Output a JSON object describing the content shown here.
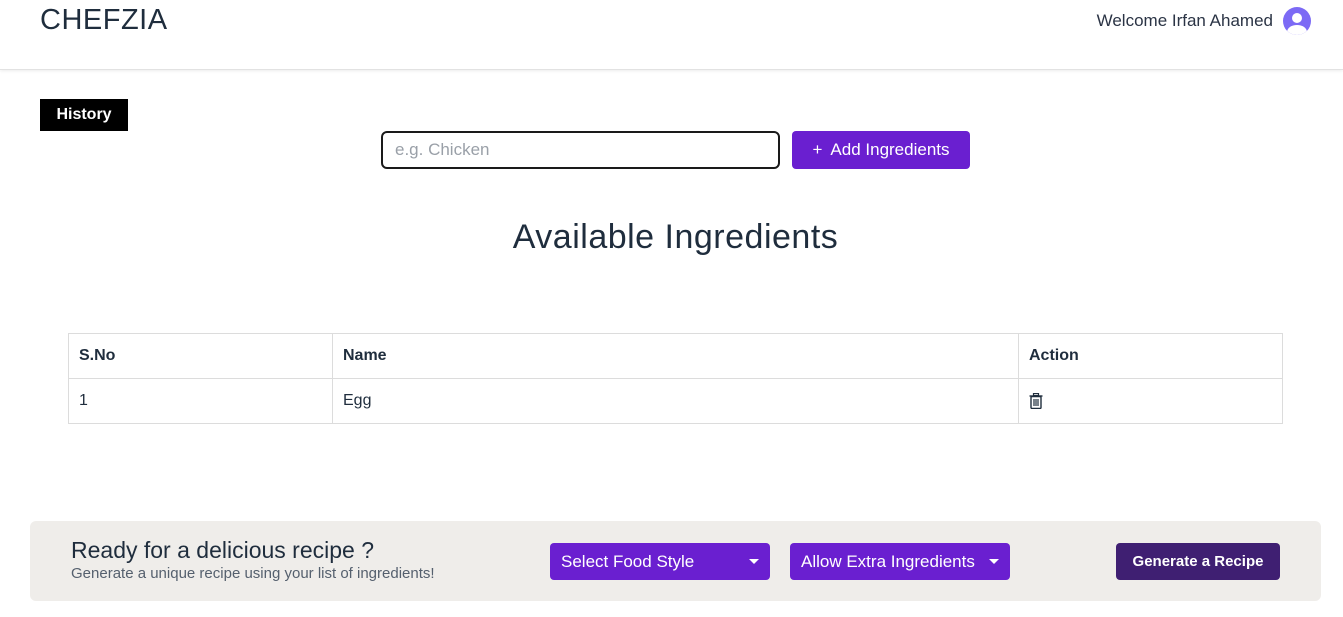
{
  "header": {
    "brand": "CHEFZIA",
    "welcome": "Welcome Irfan Ahamed",
    "avatar_icon": "user-avatar-icon"
  },
  "history": {
    "label": "History"
  },
  "ingredient_form": {
    "placeholder": "e.g. Chicken",
    "value": "",
    "add_label": "Add Ingredients",
    "add_icon": "plus-icon"
  },
  "page_title": "Available Ingredients",
  "table": {
    "headers": [
      "S.No",
      "Name",
      "Action"
    ],
    "rows": [
      {
        "sno": "1",
        "name": "Egg",
        "action_icon": "trash-icon"
      }
    ]
  },
  "footer": {
    "title": "Ready for a delicious recipe ?",
    "subtitle": "Generate a unique recipe using your list of ingredients!",
    "food_style_label": "Select Food Style",
    "extra_ingredients_label": "Allow Extra Ingredients",
    "generate_label": "Generate a Recipe"
  },
  "colors": {
    "accent": "#6a1fd0",
    "generate_button": "#3f1f72",
    "avatar": "#7c6af5",
    "footer_bg": "#efedea",
    "history_button": "#000000"
  }
}
